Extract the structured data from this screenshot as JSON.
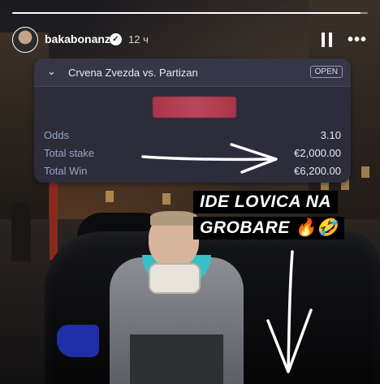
{
  "story": {
    "username": "bakabonanza",
    "verified_glyph": "✓",
    "time_ago": "12 ч",
    "progress_fraction": 0.98,
    "icons": {
      "pause": "pause-icon",
      "more": "more-options-icon",
      "verified": "verified-badge-icon"
    }
  },
  "bet_card": {
    "match": "Crvena Zvezda vs. Partizan",
    "status_badge": "OPEN",
    "rows": [
      {
        "label": "Odds",
        "value": "3.10"
      },
      {
        "label": "Total stake",
        "value": "€2,000.00"
      },
      {
        "label": "Total Win",
        "value": "€6,200.00"
      }
    ],
    "colors": {
      "card_bg": "#2c2c3a",
      "label": "#9aa4c4"
    }
  },
  "captions": {
    "line1": "IDE LOVICA NA",
    "line2": "GROBARE 🔥🤣"
  }
}
